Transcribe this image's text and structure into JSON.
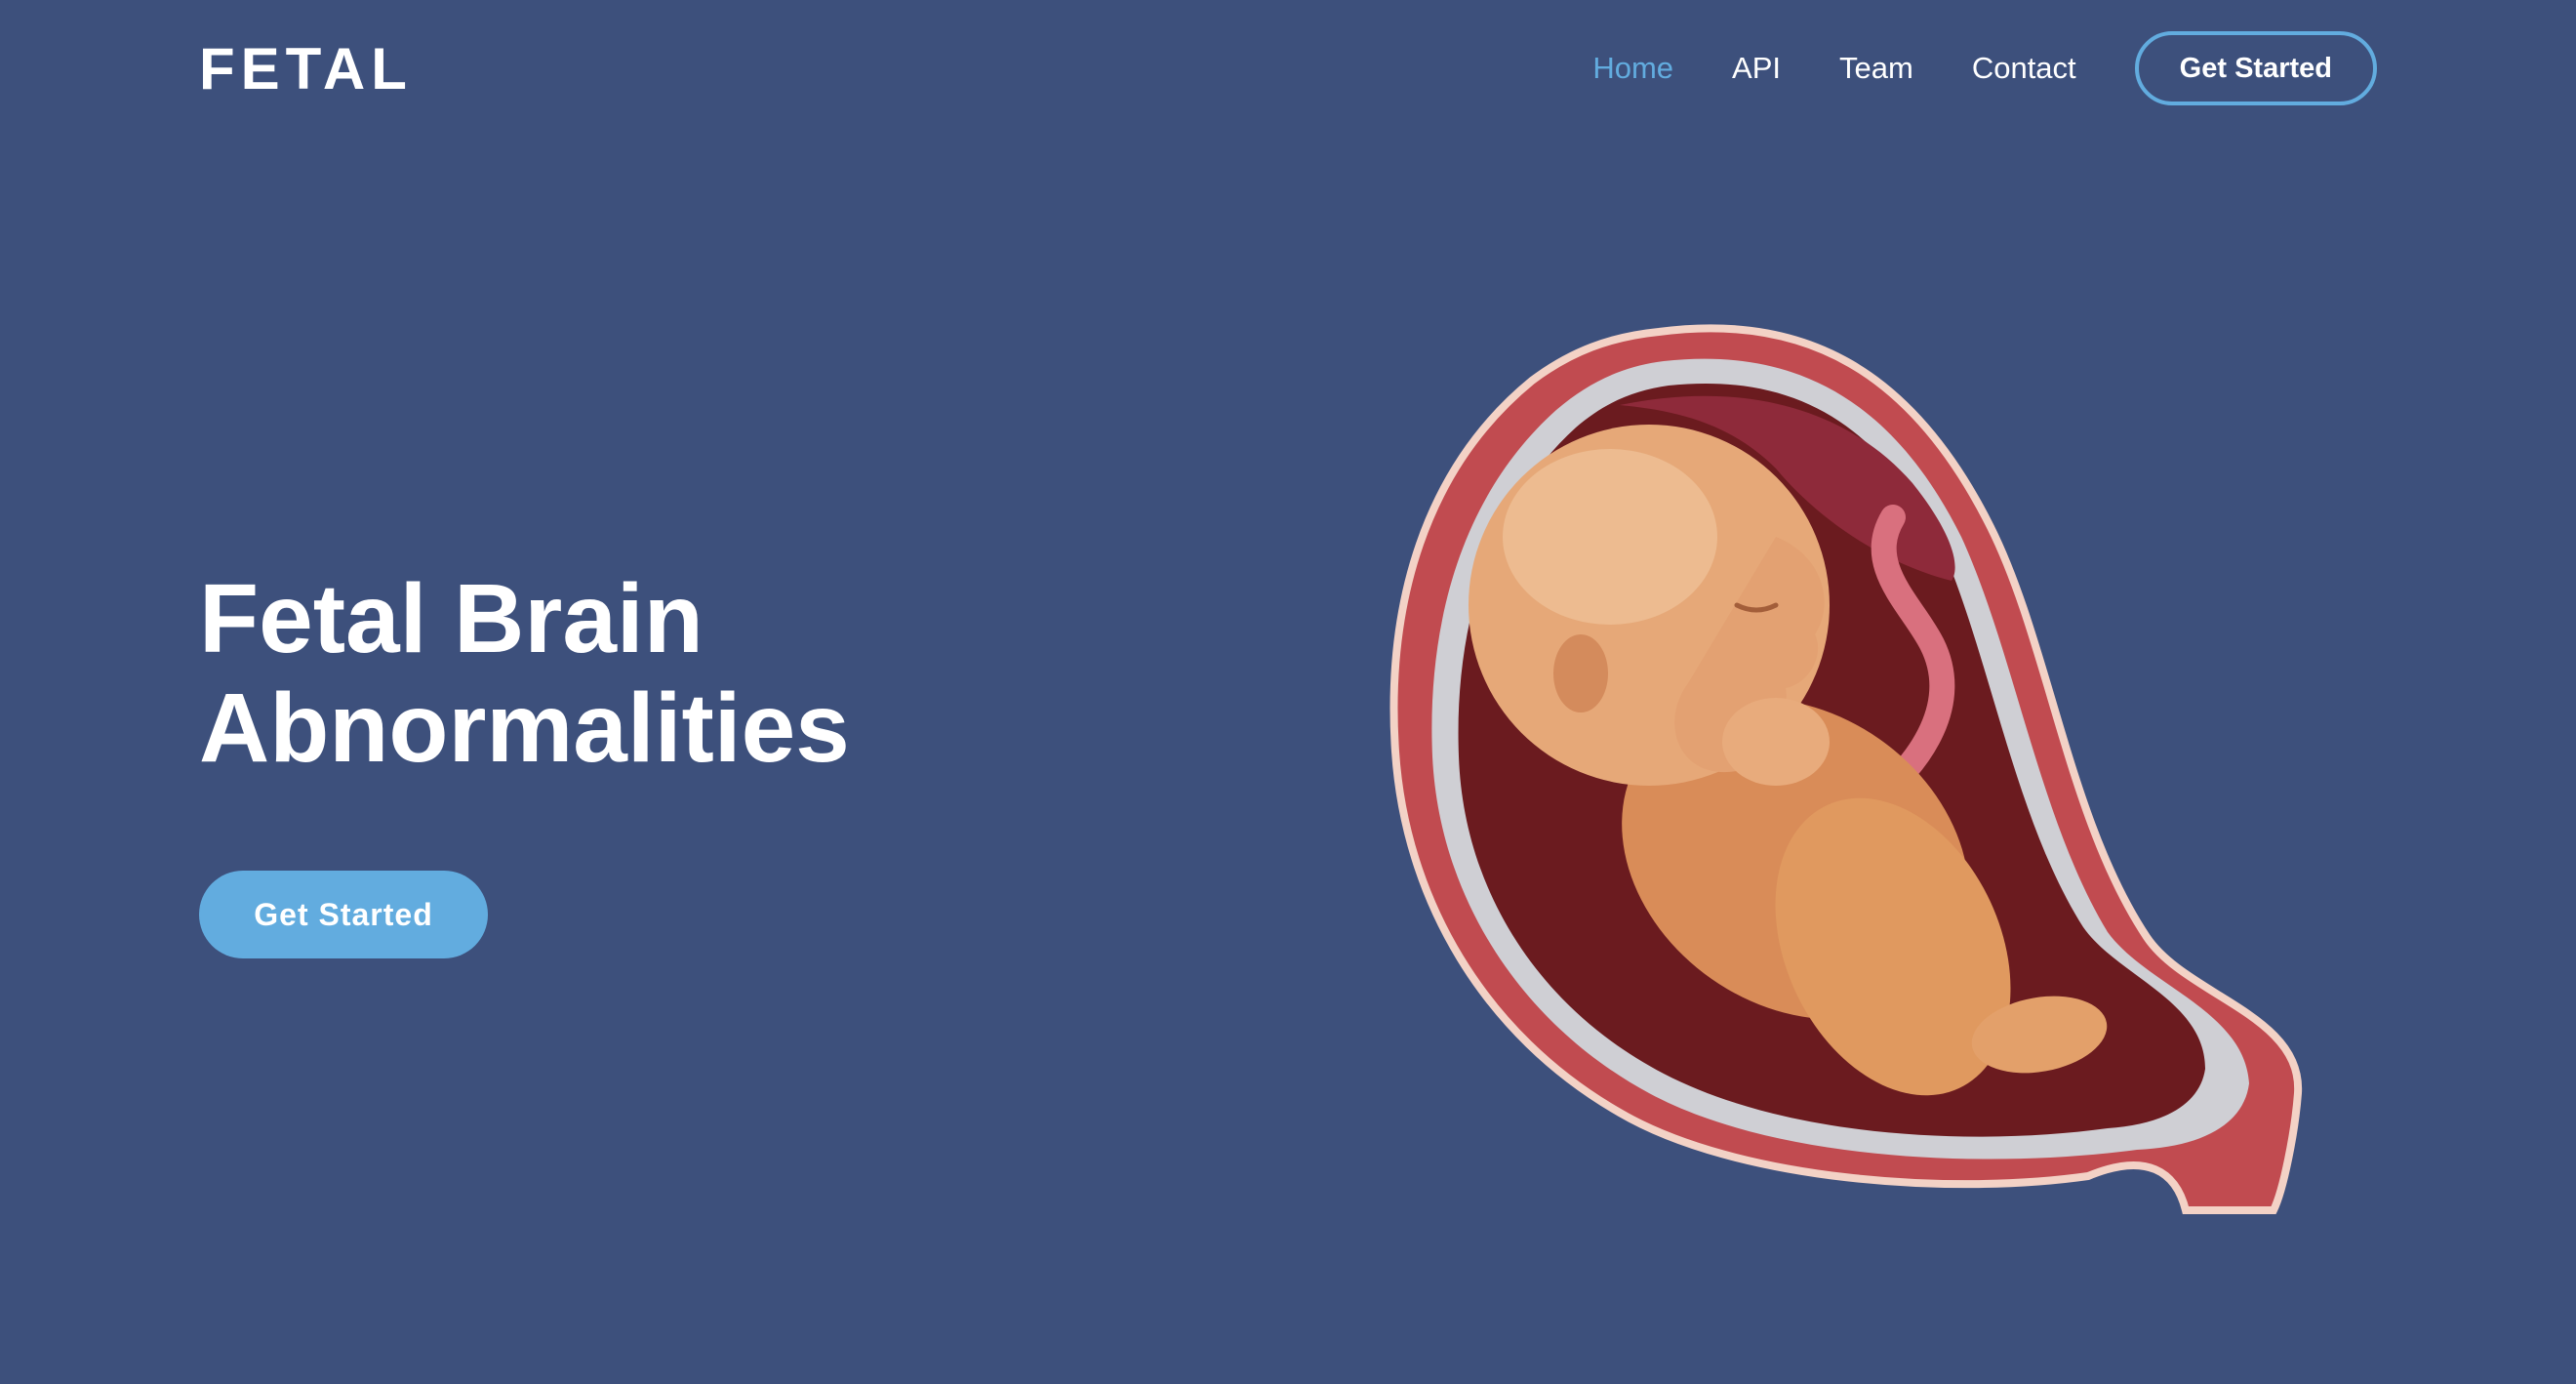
{
  "header": {
    "logo": "FETAL",
    "nav": [
      {
        "label": "Home",
        "active": true
      },
      {
        "label": "API",
        "active": false
      },
      {
        "label": "Team",
        "active": false
      },
      {
        "label": "Contact",
        "active": false
      }
    ],
    "cta_label": "Get Started"
  },
  "hero": {
    "title_line1": "Fetal Brain",
    "title_line2": "Abnormalities",
    "cta_label": "Get Started",
    "illustration": "fetus-in-womb-illustration"
  },
  "colors": {
    "background": "#3d507c",
    "accent": "#62acdf",
    "text": "#ffffff"
  }
}
